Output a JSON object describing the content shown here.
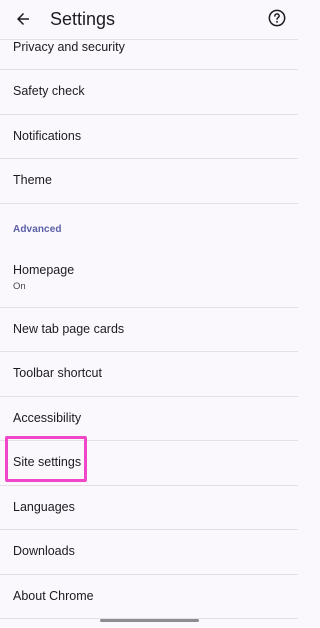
{
  "app_bar": {
    "title": "Settings",
    "back_icon": "arrow-back-icon",
    "help_icon": "help-icon"
  },
  "items": [
    {
      "label": "Privacy and security"
    },
    {
      "label": "Safety check"
    },
    {
      "label": "Notifications"
    },
    {
      "label": "Theme"
    },
    {
      "label": "Advanced"
    },
    {
      "label": "Homepage",
      "sub": "On"
    },
    {
      "label": "New tab page cards"
    },
    {
      "label": "Toolbar shortcut"
    },
    {
      "label": "Accessibility"
    },
    {
      "label": "Site settings"
    },
    {
      "label": "Languages"
    },
    {
      "label": "Downloads"
    },
    {
      "label": "About Chrome"
    }
  ],
  "colors": {
    "background": "#fbf8fd",
    "section_header": "#5a5fa6",
    "highlight": "#f046c8",
    "divider": "#e4e1e6"
  }
}
